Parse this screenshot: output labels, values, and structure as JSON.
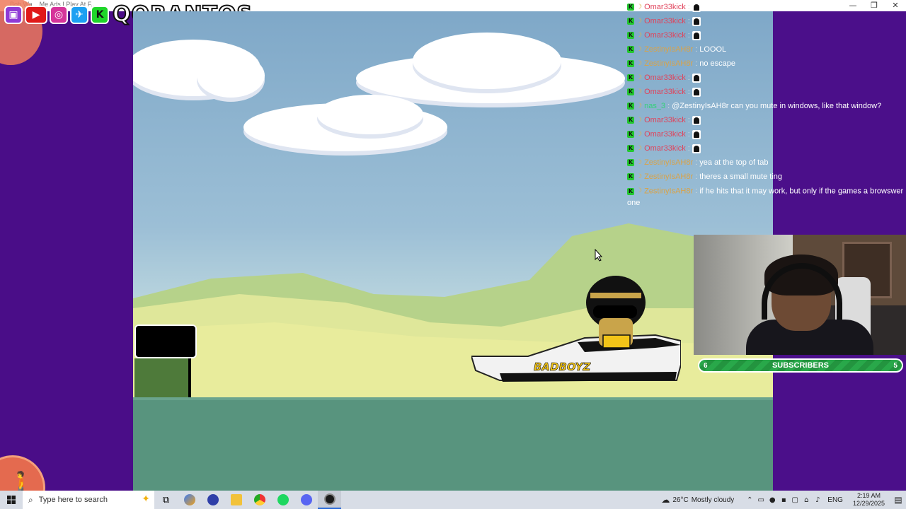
{
  "window": {
    "title": "Bob Wa... Me Ads I Play At F...",
    "minimize": "—",
    "maximize": "❐",
    "close": "✕"
  },
  "branding": {
    "channel_name": "QORANTOS",
    "socials": [
      "twitch",
      "youtube",
      "instagram",
      "twitter",
      "kick"
    ],
    "kick_letter": "K"
  },
  "game": {
    "boat_brand": "BADBOYZ"
  },
  "chat": {
    "messages": [
      {
        "user": "Omar33kick",
        "color": "#e0425a",
        "text": "",
        "emote": true
      },
      {
        "user": "Omar33kick",
        "color": "#e0425a",
        "text": "",
        "emote": true
      },
      {
        "user": "Omar33kick",
        "color": "#e0425a",
        "text": "",
        "emote": true
      },
      {
        "user": "ZestinyIsAH8r",
        "color": "#d8a34a",
        "text": "LOOOL",
        "emote": false
      },
      {
        "user": "ZestinyIsAH8r",
        "color": "#d8a34a",
        "text": "no escape",
        "emote": false
      },
      {
        "user": "Omar33kick",
        "color": "#e0425a",
        "text": "",
        "emote": true
      },
      {
        "user": "Omar33kick",
        "color": "#e0425a",
        "text": "",
        "emote": true
      },
      {
        "user": "nas_3",
        "color": "#35d07a",
        "text": "@ZestinyIsAH8r can you mute in windows, like that window?",
        "emote": false
      },
      {
        "user": "Omar33kick",
        "color": "#e0425a",
        "text": "",
        "emote": true
      },
      {
        "user": "Omar33kick",
        "color": "#e0425a",
        "text": "",
        "emote": true
      },
      {
        "user": "Omar33kick",
        "color": "#e0425a",
        "text": "",
        "emote": true
      },
      {
        "user": "ZestinyIsAH8r",
        "color": "#d8a34a",
        "text": "yea at the top of tab",
        "emote": false
      },
      {
        "user": "ZestinyIsAH8r",
        "color": "#d8a34a",
        "text": "theres a small mute ting",
        "emote": false
      },
      {
        "user": "ZestinyIsAH8r",
        "color": "#d8a34a",
        "text": "if he hits that it may work, but only if the games a browswer one",
        "emote": false
      }
    ]
  },
  "subscribers": {
    "label": "SUBSCRIBERS",
    "current": "6",
    "goal": "5"
  },
  "taskbar": {
    "search_placeholder": "Type here to search",
    "apps": [
      "task-view",
      "copilot",
      "app-blue",
      "file-explorer",
      "chrome",
      "spotify",
      "discord",
      "obs"
    ],
    "weather_temp": "26°C",
    "weather_desc": "Mostly cloudy",
    "language": "ENG",
    "time": "2:19 AM",
    "date": "12/29/2025"
  }
}
